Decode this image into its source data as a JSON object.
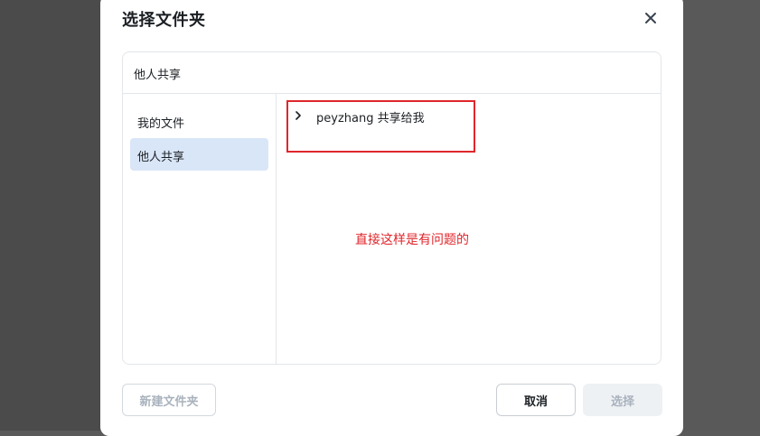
{
  "dialog": {
    "title": "选择文件夹",
    "close_icon": "close-icon"
  },
  "panel": {
    "header": "他人共享"
  },
  "sidebar": {
    "items": [
      {
        "label": "我的文件",
        "active": false
      },
      {
        "label": "他人共享",
        "active": true
      }
    ]
  },
  "tree": {
    "items": [
      {
        "label": "peyzhang 共享给我",
        "icon": "chevron-right-icon"
      }
    ]
  },
  "annotation": {
    "text": "直接这样是有问题的",
    "color": "#e0262b"
  },
  "footer": {
    "new_folder_label": "新建文件夹",
    "cancel_label": "取消",
    "select_label": "选择"
  },
  "colors": {
    "accent_selected_bg": "#d9e6f7",
    "disabled_text": "#a9b2bd"
  }
}
